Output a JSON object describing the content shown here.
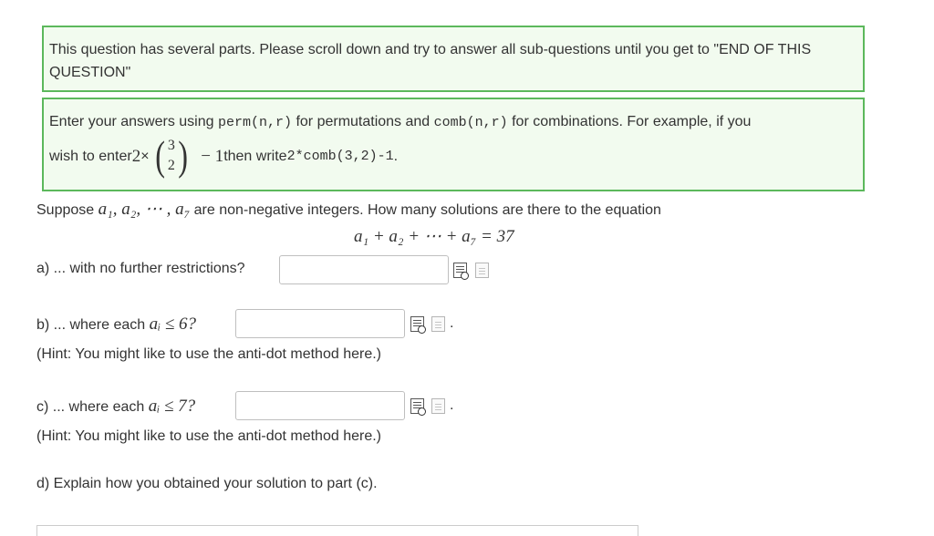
{
  "notice": {
    "text": "This question has several parts. Please scroll down and try to answer all sub-questions until you get to \"END OF THIS QUESTION\""
  },
  "instructions": {
    "text1": "Enter your answers using ",
    "code_perm": "perm(n,r)",
    "text2": " for permutations and ",
    "code_comb": "comb(n,r)",
    "text3": " for combinations. For example, if you",
    "text4": "wish to enter ",
    "math_two": "2",
    "times": " × ",
    "binom_top": "3",
    "binom_bottom": "2",
    "math_minus_one": "− 1",
    "text5": " then write ",
    "code_example": "2*comb(3,2)-1",
    "text6": "."
  },
  "question": {
    "intro_prefix": "Suppose ",
    "intro_vars": "a₁, a₂, ⋯ , a₇",
    "intro_suffix": " are non-negative integers. How many solutions are there to the equation",
    "equation": "a₁ + a₂ + ⋯ + a₇ = 37"
  },
  "parts": {
    "a_label": "a) ... with no further restrictions?",
    "a_value": "",
    "b_label": "b) ... where each ",
    "b_math": "aᵢ ≤ 6?",
    "b_value": "",
    "b_hint": "(Hint: You might like to use the anti-dot method here.)",
    "c_label": "c) ... where each ",
    "c_math": "aᵢ ≤ 7?",
    "c_value": "",
    "c_hint": "(Hint: You might like to use the anti-dot method here.)",
    "d_label": "d) Explain how you obtained your solution to part (c)."
  },
  "icons": {
    "preview": "preview-icon",
    "file": "file-icon"
  },
  "colors": {
    "box_border": "#5cb85c",
    "box_background": "#f2fbef",
    "text": "#333333"
  }
}
